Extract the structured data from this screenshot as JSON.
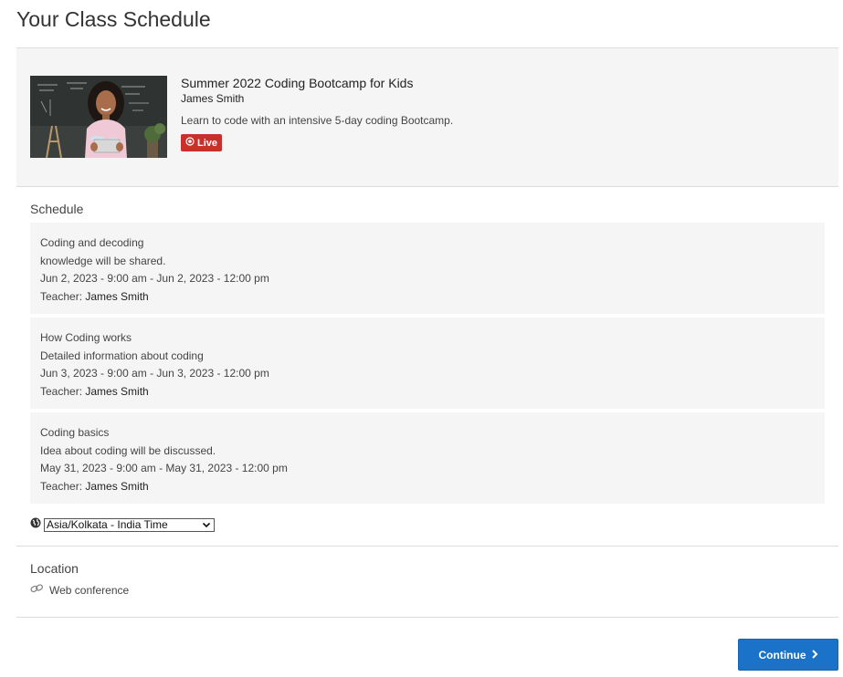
{
  "page": {
    "title": "Your Class Schedule"
  },
  "course": {
    "title": "Summer 2022 Coding Bootcamp for Kids",
    "instructor": "James Smith",
    "description": "Learn to code with an intensive 5-day coding Bootcamp.",
    "badge": "Live",
    "badge_color": "#c9302c",
    "thumbnail_icon": "girl-with-tablet-photo"
  },
  "schedule": {
    "heading": "Schedule",
    "teacher_label": "Teacher:",
    "sessions": [
      {
        "title": "Coding and decoding",
        "description": "knowledge will be shared.",
        "time": "Jun 2, 2023 - 9:00 am - Jun 2, 2023 - 12:00 pm",
        "teacher": "James Smith"
      },
      {
        "title": "How Coding works",
        "description": "Detailed information about coding",
        "time": "Jun 3, 2023 - 9:00 am - Jun 3, 2023 - 12:00 pm",
        "teacher": "James Smith"
      },
      {
        "title": "Coding basics",
        "description": "Idea about coding will be discussed.",
        "time": "May 31, 2023 - 9:00 am - May 31, 2023 - 12:00 pm",
        "teacher": "James Smith"
      }
    ]
  },
  "timezone": {
    "selected": "Asia/Kolkata - India Time",
    "icon": "globe-icon"
  },
  "location": {
    "heading": "Location",
    "value": "Web conference",
    "icon": "link-icon"
  },
  "actions": {
    "continue_label": "Continue",
    "accent": "#1a73c9"
  }
}
